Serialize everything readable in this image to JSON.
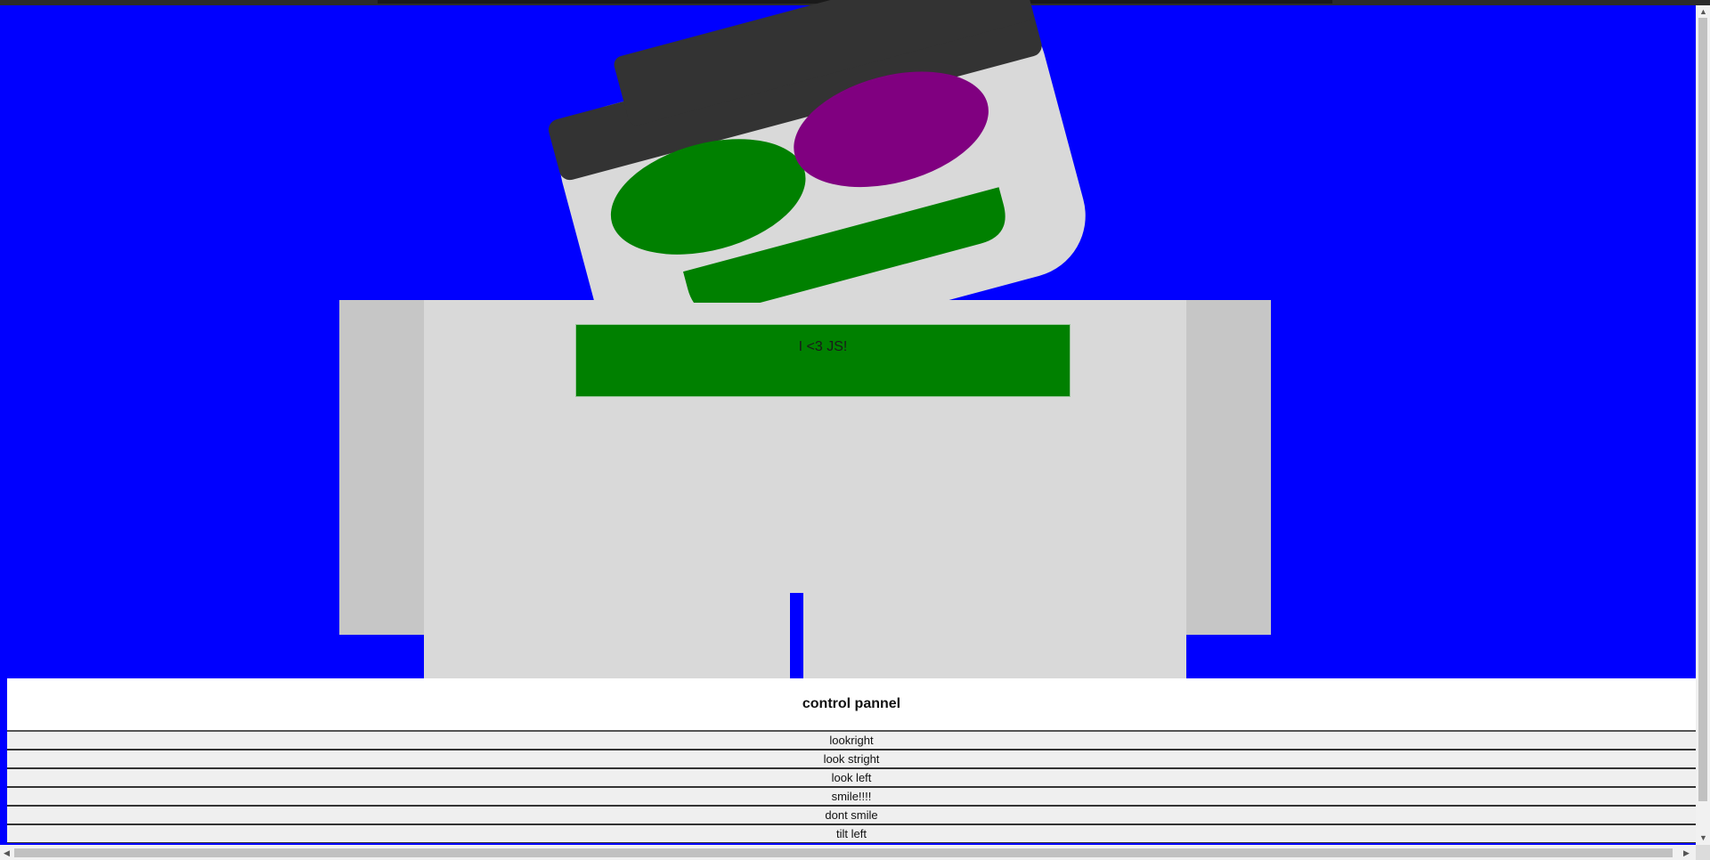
{
  "robot": {
    "shirt_text": "I <3 JS!",
    "colors": {
      "background": "#0000ff",
      "head": "#d9d9d9",
      "hat": "#333333",
      "left_eye": "#008000",
      "right_eye": "#800080",
      "mouth": "#008000",
      "screen": "#008000"
    }
  },
  "control_panel": {
    "title": "control pannel",
    "buttons": [
      {
        "label": "lookright"
      },
      {
        "label": "look stright"
      },
      {
        "label": "look left"
      },
      {
        "label": "smile!!!!"
      },
      {
        "label": "dont smile"
      },
      {
        "label": "tilt left"
      }
    ]
  }
}
